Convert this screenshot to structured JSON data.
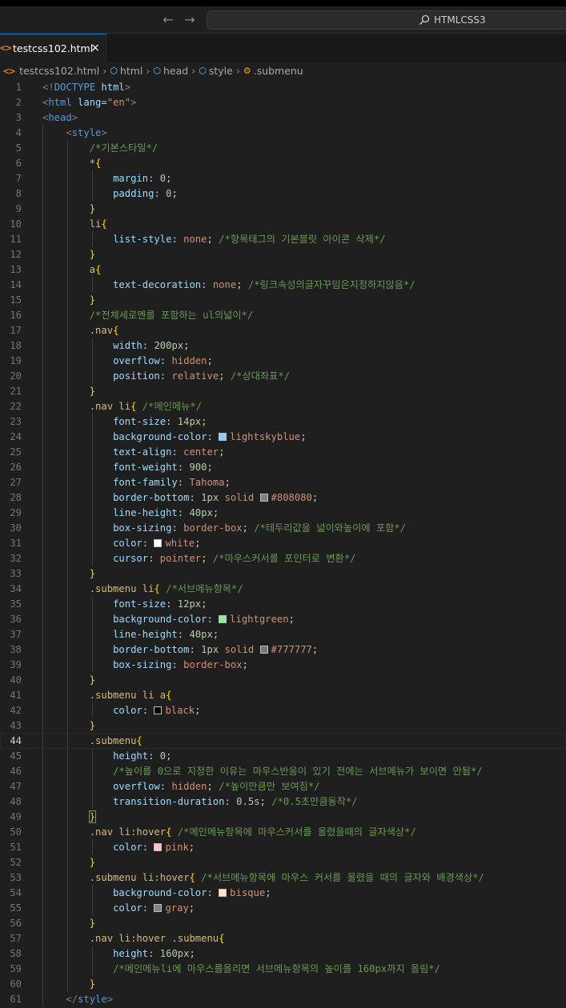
{
  "titlebar": {
    "back_icon": "arrow-left-icon",
    "forward_icon": "arrow-right-icon",
    "search_icon": "search-icon",
    "command_center_text": "HTMLCSS3"
  },
  "tab": {
    "label": "testcss102.html",
    "file_icon": "<>",
    "close_icon": "×"
  },
  "breadcrumb": {
    "file": "testcss102.html",
    "items": [
      "html",
      "head",
      "style",
      ".submenu"
    ]
  },
  "editor": {
    "active_line": 44,
    "lines": [
      [
        [
          "t-punct",
          "<!"
        ],
        [
          "t-tag",
          "DOCTYPE"
        ],
        [
          "t-text",
          " "
        ],
        [
          "t-attr",
          "html"
        ],
        [
          "t-punct",
          ">"
        ]
      ],
      [
        [
          "t-punct",
          "<"
        ],
        [
          "t-tag",
          "html"
        ],
        [
          "t-text",
          " "
        ],
        [
          "t-attr",
          "lang"
        ],
        [
          "t-text",
          "="
        ],
        [
          "t-str",
          "\"en\""
        ],
        [
          "t-punct",
          ">"
        ]
      ],
      [
        [
          "t-punct",
          "<"
        ],
        [
          "t-tag",
          "head"
        ],
        [
          "t-punct",
          ">"
        ]
      ],
      [
        [
          "t-text",
          "    "
        ],
        [
          "t-punct",
          "<"
        ],
        [
          "t-tag",
          "style"
        ],
        [
          "t-punct",
          ">"
        ]
      ],
      [
        [
          "t-text",
          "        "
        ],
        [
          "t-cmt",
          "/*기본스타일*/"
        ]
      ],
      [
        [
          "t-text",
          "        "
        ],
        [
          "t-sel",
          "*"
        ],
        [
          "t-brace",
          "{"
        ]
      ],
      [
        [
          "t-text",
          "            "
        ],
        [
          "t-prop",
          "margin"
        ],
        [
          "t-text",
          ": "
        ],
        [
          "t-num",
          "0"
        ],
        [
          "t-text",
          ";"
        ]
      ],
      [
        [
          "t-text",
          "            "
        ],
        [
          "t-prop",
          "padding"
        ],
        [
          "t-text",
          ": "
        ],
        [
          "t-num",
          "0"
        ],
        [
          "t-text",
          ";"
        ]
      ],
      [
        [
          "t-text",
          "        "
        ],
        [
          "t-brace",
          "}"
        ]
      ],
      [
        [
          "t-text",
          "        "
        ],
        [
          "t-sel",
          "li"
        ],
        [
          "t-brace",
          "{"
        ]
      ],
      [
        [
          "t-text",
          "            "
        ],
        [
          "t-prop",
          "list-style"
        ],
        [
          "t-text",
          ": "
        ],
        [
          "t-val",
          "none"
        ],
        [
          "t-text",
          "; "
        ],
        [
          "t-cmt",
          "/*항목태그의 기본블릿 아이콘 삭제*/"
        ]
      ],
      [
        [
          "t-text",
          "        "
        ],
        [
          "t-brace",
          "}"
        ]
      ],
      [
        [
          "t-text",
          "        "
        ],
        [
          "t-sel",
          "a"
        ],
        [
          "t-brace",
          "{"
        ]
      ],
      [
        [
          "t-text",
          "            "
        ],
        [
          "t-prop",
          "text-decoration"
        ],
        [
          "t-text",
          ": "
        ],
        [
          "t-val",
          "none"
        ],
        [
          "t-text",
          "; "
        ],
        [
          "t-cmt",
          "/*링크속성의글자꾸밈은지정하지않음*/"
        ]
      ],
      [
        [
          "t-text",
          "        "
        ],
        [
          "t-brace",
          "}"
        ]
      ],
      [
        [
          "t-text",
          "        "
        ],
        [
          "t-cmt",
          "/*전체세로멘를 포함하는 ul의넓이*/"
        ]
      ],
      [
        [
          "t-text",
          "        "
        ],
        [
          "t-sel",
          ".nav"
        ],
        [
          "t-brace",
          "{"
        ]
      ],
      [
        [
          "t-text",
          "            "
        ],
        [
          "t-prop",
          "width"
        ],
        [
          "t-text",
          ": "
        ],
        [
          "t-num",
          "200px"
        ],
        [
          "t-text",
          ";"
        ]
      ],
      [
        [
          "t-text",
          "            "
        ],
        [
          "t-prop",
          "overflow"
        ],
        [
          "t-text",
          ": "
        ],
        [
          "t-val",
          "hidden"
        ],
        [
          "t-text",
          ";"
        ]
      ],
      [
        [
          "t-text",
          "            "
        ],
        [
          "t-prop",
          "position"
        ],
        [
          "t-text",
          ": "
        ],
        [
          "t-val",
          "relative"
        ],
        [
          "t-text",
          "; "
        ],
        [
          "t-cmt",
          "/*상대좌표*/"
        ]
      ],
      [
        [
          "t-text",
          "        "
        ],
        [
          "t-brace",
          "}"
        ]
      ],
      [
        [
          "t-text",
          "        "
        ],
        [
          "t-sel",
          ".nav li"
        ],
        [
          "t-brace",
          "{"
        ],
        [
          "t-text",
          " "
        ],
        [
          "t-cmt",
          "/*메인메뉴*/"
        ]
      ],
      [
        [
          "t-text",
          "            "
        ],
        [
          "t-prop",
          "font-size"
        ],
        [
          "t-text",
          ": "
        ],
        [
          "t-num",
          "14px"
        ],
        [
          "t-text",
          ";"
        ]
      ],
      [
        [
          "t-text",
          "            "
        ],
        [
          "t-prop",
          "background-color"
        ],
        [
          "t-text",
          ": "
        ],
        [
          "swatch",
          "#87cefa"
        ],
        [
          "t-val",
          "lightskyblue"
        ],
        [
          "t-text",
          ";"
        ]
      ],
      [
        [
          "t-text",
          "            "
        ],
        [
          "t-prop",
          "text-align"
        ],
        [
          "t-text",
          ": "
        ],
        [
          "t-val",
          "center"
        ],
        [
          "t-text",
          ";"
        ]
      ],
      [
        [
          "t-text",
          "            "
        ],
        [
          "t-prop",
          "font-weight"
        ],
        [
          "t-text",
          ": "
        ],
        [
          "t-num",
          "900"
        ],
        [
          "t-text",
          ";"
        ]
      ],
      [
        [
          "t-text",
          "            "
        ],
        [
          "t-prop",
          "font-family"
        ],
        [
          "t-text",
          ": "
        ],
        [
          "t-val",
          "Tahoma"
        ],
        [
          "t-text",
          ";"
        ]
      ],
      [
        [
          "t-text",
          "            "
        ],
        [
          "t-prop",
          "border-bottom"
        ],
        [
          "t-text",
          ": "
        ],
        [
          "t-num",
          "1px"
        ],
        [
          "t-text",
          " "
        ],
        [
          "t-val",
          "solid"
        ],
        [
          "t-text",
          " "
        ],
        [
          "swatch",
          "#808080"
        ],
        [
          "t-val",
          "#808080"
        ],
        [
          "t-text",
          ";"
        ]
      ],
      [
        [
          "t-text",
          "            "
        ],
        [
          "t-prop",
          "line-height"
        ],
        [
          "t-text",
          ": "
        ],
        [
          "t-num",
          "40px"
        ],
        [
          "t-text",
          ";"
        ]
      ],
      [
        [
          "t-text",
          "            "
        ],
        [
          "t-prop",
          "box-sizing"
        ],
        [
          "t-text",
          ": "
        ],
        [
          "t-val",
          "border-box"
        ],
        [
          "t-text",
          "; "
        ],
        [
          "t-cmt",
          "/*테두리값을 넓이와높이에 포함*/"
        ]
      ],
      [
        [
          "t-text",
          "            "
        ],
        [
          "t-prop",
          "color"
        ],
        [
          "t-text",
          ": "
        ],
        [
          "swatch",
          "#ffffff"
        ],
        [
          "t-val",
          "white"
        ],
        [
          "t-text",
          ";"
        ]
      ],
      [
        [
          "t-text",
          "            "
        ],
        [
          "t-prop",
          "cursor"
        ],
        [
          "t-text",
          ": "
        ],
        [
          "t-val",
          "pointer"
        ],
        [
          "t-text",
          "; "
        ],
        [
          "t-cmt",
          "/*마우스커서를 포인터로 변환*/"
        ]
      ],
      [
        [
          "t-text",
          "        "
        ],
        [
          "t-brace",
          "}"
        ]
      ],
      [
        [
          "t-text",
          "        "
        ],
        [
          "t-sel",
          ".submenu li"
        ],
        [
          "t-brace",
          "{"
        ],
        [
          "t-text",
          " "
        ],
        [
          "t-cmt",
          "/*서브메뉴항목*/"
        ]
      ],
      [
        [
          "t-text",
          "            "
        ],
        [
          "t-prop",
          "font-size"
        ],
        [
          "t-text",
          ": "
        ],
        [
          "t-num",
          "12px"
        ],
        [
          "t-text",
          ";"
        ]
      ],
      [
        [
          "t-text",
          "            "
        ],
        [
          "t-prop",
          "background-color"
        ],
        [
          "t-text",
          ": "
        ],
        [
          "swatch",
          "#90ee90"
        ],
        [
          "t-val",
          "lightgreen"
        ],
        [
          "t-text",
          ";"
        ]
      ],
      [
        [
          "t-text",
          "            "
        ],
        [
          "t-prop",
          "line-height"
        ],
        [
          "t-text",
          ": "
        ],
        [
          "t-num",
          "40px"
        ],
        [
          "t-text",
          ";"
        ]
      ],
      [
        [
          "t-text",
          "            "
        ],
        [
          "t-prop",
          "border-bottom"
        ],
        [
          "t-text",
          ": "
        ],
        [
          "t-num",
          "1px"
        ],
        [
          "t-text",
          " "
        ],
        [
          "t-val",
          "solid"
        ],
        [
          "t-text",
          " "
        ],
        [
          "swatch",
          "#777777"
        ],
        [
          "t-val",
          "#777777"
        ],
        [
          "t-text",
          ";"
        ]
      ],
      [
        [
          "t-text",
          "            "
        ],
        [
          "t-prop",
          "box-sizing"
        ],
        [
          "t-text",
          ": "
        ],
        [
          "t-val",
          "border-box"
        ],
        [
          "t-text",
          ";"
        ]
      ],
      [
        [
          "t-text",
          "        "
        ],
        [
          "t-brace",
          "}"
        ]
      ],
      [
        [
          "t-text",
          "        "
        ],
        [
          "t-sel",
          ".submenu li a"
        ],
        [
          "t-brace",
          "{"
        ]
      ],
      [
        [
          "t-text",
          "            "
        ],
        [
          "t-prop",
          "color"
        ],
        [
          "t-text",
          ": "
        ],
        [
          "swatch",
          "#000000"
        ],
        [
          "t-val",
          "black"
        ],
        [
          "t-text",
          ";"
        ]
      ],
      [
        [
          "t-text",
          "        "
        ],
        [
          "t-brace",
          "}"
        ]
      ],
      [
        [
          "t-text",
          "        "
        ],
        [
          "t-sel",
          ".submenu"
        ],
        [
          "t-brace",
          "{"
        ]
      ],
      [
        [
          "t-text",
          "            "
        ],
        [
          "t-prop",
          "height"
        ],
        [
          "t-text",
          ": "
        ],
        [
          "t-num",
          "0"
        ],
        [
          "t-text",
          ";"
        ]
      ],
      [
        [
          "t-text",
          "            "
        ],
        [
          "t-cmt",
          "/*높이를 0으로 지정한 이유는 마우스반응이 있기 전에는 서브메뉴가 보이면 안됨*/"
        ]
      ],
      [
        [
          "t-text",
          "            "
        ],
        [
          "t-prop",
          "overflow"
        ],
        [
          "t-text",
          ": "
        ],
        [
          "t-val",
          "hidden"
        ],
        [
          "t-text",
          "; "
        ],
        [
          "t-cmt",
          "/*높이만큼만 보여짐*/"
        ]
      ],
      [
        [
          "t-text",
          "            "
        ],
        [
          "t-prop",
          "transition-duration"
        ],
        [
          "t-text",
          ": "
        ],
        [
          "t-num",
          "0.5s"
        ],
        [
          "t-text",
          "; "
        ],
        [
          "t-cmt",
          "/*0.5초만큼동작*/"
        ]
      ],
      [
        [
          "t-text",
          "        "
        ],
        [
          "t-bracebox",
          "}"
        ]
      ],
      [
        [
          "t-text",
          "        "
        ],
        [
          "t-sel",
          ".nav li:hover"
        ],
        [
          "t-brace",
          "{"
        ],
        [
          "t-text",
          " "
        ],
        [
          "t-cmt",
          "/*메인메뉴항목에 마우스커서를 올렸을때의 글자색상*/"
        ]
      ],
      [
        [
          "t-text",
          "            "
        ],
        [
          "t-prop",
          "color"
        ],
        [
          "t-text",
          ": "
        ],
        [
          "swatch",
          "#ffc0cb"
        ],
        [
          "t-val",
          "pink"
        ],
        [
          "t-text",
          ";"
        ]
      ],
      [
        [
          "t-text",
          "        "
        ],
        [
          "t-brace",
          "}"
        ]
      ],
      [
        [
          "t-text",
          "        "
        ],
        [
          "t-sel",
          ".submenu li:hover"
        ],
        [
          "t-brace",
          "{"
        ],
        [
          "t-text",
          " "
        ],
        [
          "t-cmt",
          "/*서브메뉴항목에 마우스 커서를 올렸을 때의 글자와 배경색상*/"
        ]
      ],
      [
        [
          "t-text",
          "            "
        ],
        [
          "t-prop",
          "background-color"
        ],
        [
          "t-text",
          ": "
        ],
        [
          "swatch",
          "#ffe4c4"
        ],
        [
          "t-val",
          "bisque"
        ],
        [
          "t-text",
          ";"
        ]
      ],
      [
        [
          "t-text",
          "            "
        ],
        [
          "t-prop",
          "color"
        ],
        [
          "t-text",
          ": "
        ],
        [
          "swatch",
          "#808080"
        ],
        [
          "t-val",
          "gray"
        ],
        [
          "t-text",
          ";"
        ]
      ],
      [
        [
          "t-text",
          "        "
        ],
        [
          "t-brace",
          "}"
        ]
      ],
      [
        [
          "t-text",
          "        "
        ],
        [
          "t-sel",
          ".nav li:hover .submenu"
        ],
        [
          "t-brace",
          "{"
        ]
      ],
      [
        [
          "t-text",
          "            "
        ],
        [
          "t-prop",
          "height"
        ],
        [
          "t-text",
          ": "
        ],
        [
          "t-num",
          "160px"
        ],
        [
          "t-text",
          ";"
        ]
      ],
      [
        [
          "t-text",
          "            "
        ],
        [
          "t-cmt",
          "/*메인메뉴li에 마우스를올리면 서브메뉴항목의 높이를 160px까지 올림*/"
        ]
      ],
      [
        [
          "t-text",
          "        "
        ],
        [
          "t-brace",
          "}"
        ]
      ],
      [
        [
          "t-text",
          "    "
        ],
        [
          "t-punct",
          "</"
        ],
        [
          "t-tag",
          "style"
        ],
        [
          "t-punct",
          ">"
        ]
      ]
    ]
  }
}
